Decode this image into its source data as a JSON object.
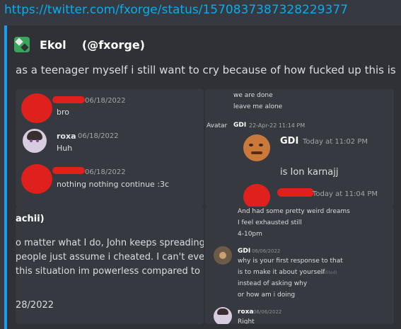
{
  "link": {
    "url": "https://twitter.com/fxorge/status/1570837387328229377"
  },
  "embed": {
    "author": "Ekol    (@fxorge)",
    "description": "as a teenager myself i still want to cry because of how fucked up this is"
  },
  "image1": {
    "msgs": [
      {
        "ts": "06/18/2022",
        "text": "bro"
      },
      {
        "name": "roxa",
        "ts": "06/18/2022",
        "text": "Huh"
      },
      {
        "ts": "06/18/2022",
        "text": "nothing nothing continue :3c"
      }
    ]
  },
  "image2": {
    "line1": "we are done",
    "line2": "leave me alone",
    "avatar_alt": "Avatar",
    "small_name": "GDI",
    "small_ts": "22-Apr-22 11:14 PM",
    "name": "GDI",
    "ts": "Today at 11:02 PM",
    "text": "is Ion karnajj",
    "ts2": "Today at 11:04 PM"
  },
  "image3": {
    "name": "achii)",
    "lines": [
      "o matter what I do, John keeps spreading",
      "people just assume i cheated. I can't eve",
      "this situation im powerless compared to"
    ],
    "date": "28/2022"
  },
  "image4": {
    "top_lines": [
      "And had some pretty weird dreams",
      "I feel exhausted still",
      "4-10pm"
    ],
    "name1": "GDI",
    "ts1": "06/06/2022",
    "lines": [
      "why is your first response to that",
      "is to make it about yourself",
      "instead of asking why",
      "or how am i doing"
    ],
    "edited": "(edited)",
    "name2": "roxa",
    "ts2": "06/06/2022",
    "text2": "Right"
  }
}
